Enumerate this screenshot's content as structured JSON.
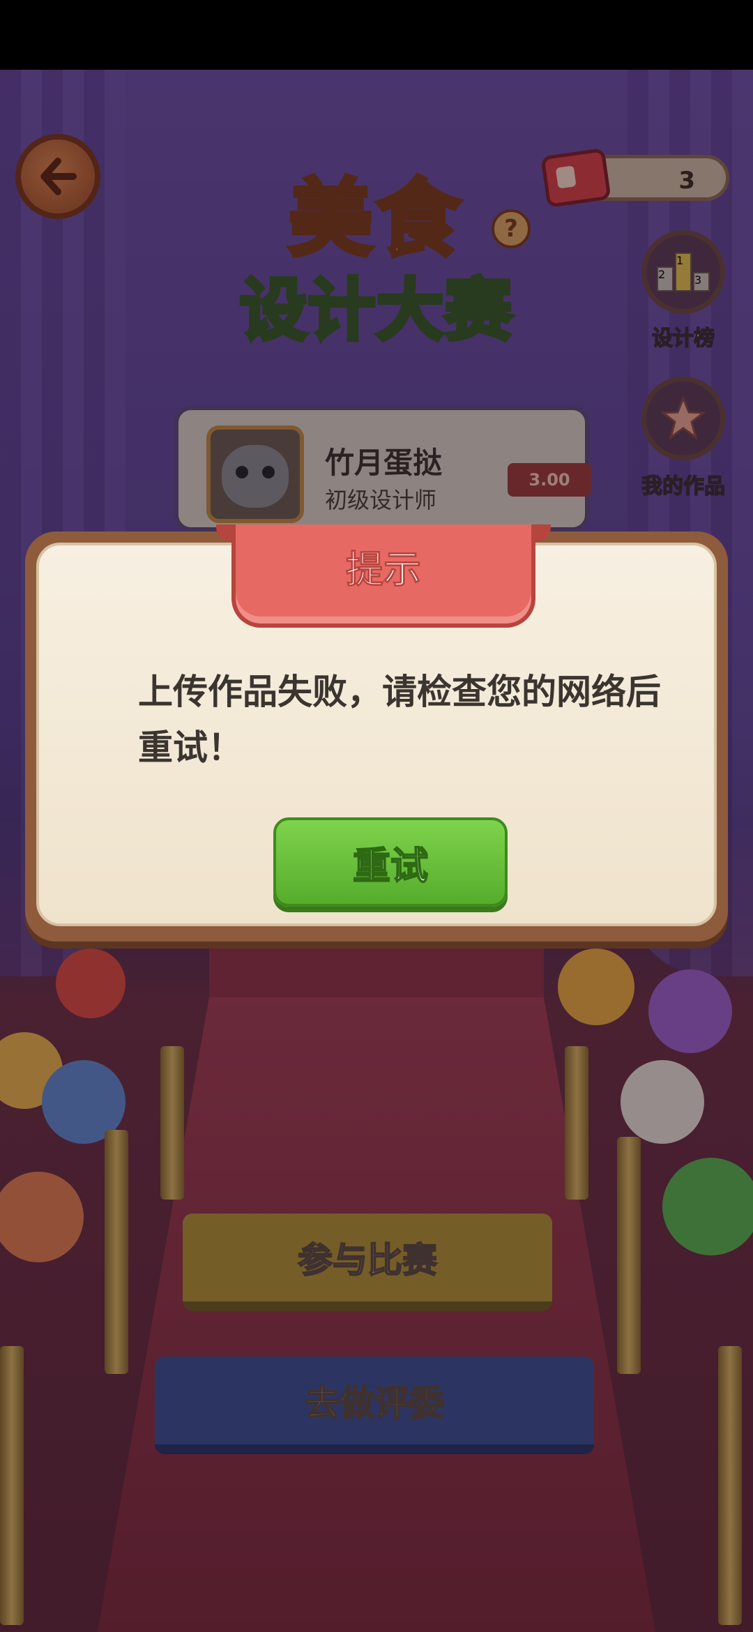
{
  "header": {
    "ticket_count": "3"
  },
  "title": {
    "line1": "美食",
    "line2": "设计大赛",
    "help": "?"
  },
  "side_menu": {
    "ranking_label": "设计榜",
    "ranking_podium": [
      "2",
      "1",
      "3"
    ],
    "my_works_label": "我的作品"
  },
  "profile": {
    "name": "竹月蛋挞",
    "level": "初级设计师",
    "score": "3.00"
  },
  "stage": {
    "join_label": "参与比赛",
    "judge_label": "去做评委"
  },
  "dialog": {
    "title": "提示",
    "message": "上传作品失败，请检查您的网络后重试！",
    "retry_label": "重试"
  },
  "colors": {
    "dialog_ribbon": "#e66a63",
    "retry_button": "#62b83a",
    "dialog_bg": "#f4ead8"
  }
}
